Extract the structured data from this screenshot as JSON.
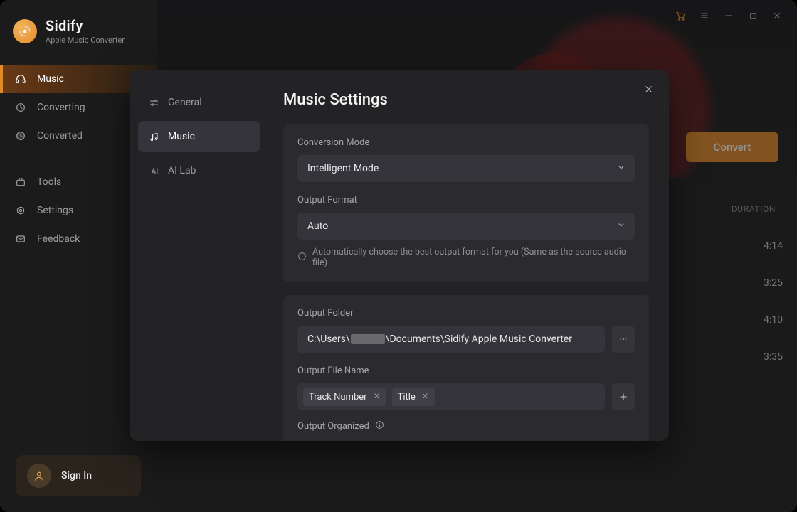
{
  "brand": {
    "name": "Sidify",
    "sub": "Apple Music Converter"
  },
  "titlebar": {
    "icons": [
      "cart",
      "hamburger",
      "minimize",
      "maximize",
      "close"
    ]
  },
  "sidebar": {
    "items": [
      {
        "label": "Music",
        "icon": "headphones",
        "active": true
      },
      {
        "label": "Converting",
        "icon": "clock"
      },
      {
        "label": "Converted",
        "icon": "clock-filled"
      }
    ],
    "items2": [
      {
        "label": "Tools",
        "icon": "briefcase"
      },
      {
        "label": "Settings",
        "icon": "gear"
      },
      {
        "label": "Feedback",
        "icon": "mail"
      }
    ],
    "signin": "Sign In"
  },
  "main": {
    "convert": "Convert",
    "col_duration": "DURATION",
    "tracks": [
      {
        "duration": "4:14"
      },
      {
        "duration": "3:25"
      },
      {
        "duration": "4:10"
      },
      {
        "duration": "3:35"
      }
    ]
  },
  "modal": {
    "title": "Music Settings",
    "side": [
      {
        "label": "General",
        "icon": "sliders"
      },
      {
        "label": "Music",
        "icon": "music",
        "active": true
      },
      {
        "label": "AI Lab",
        "icon": "ai"
      }
    ],
    "conversion_mode": {
      "label": "Conversion Mode",
      "value": "Intelligent Mode"
    },
    "output_format": {
      "label": "Output Format",
      "value": "Auto",
      "hint": "Automatically choose the best output format for you (Same as the source audio file)"
    },
    "output_folder": {
      "label": "Output Folder",
      "prefix": "C:\\Users\\",
      "suffix": "\\Documents\\Sidify Apple Music Converter"
    },
    "output_filename": {
      "label": "Output File Name",
      "tags": [
        "Track Number",
        "Title"
      ]
    },
    "output_organized": {
      "label": "Output Organized"
    }
  }
}
